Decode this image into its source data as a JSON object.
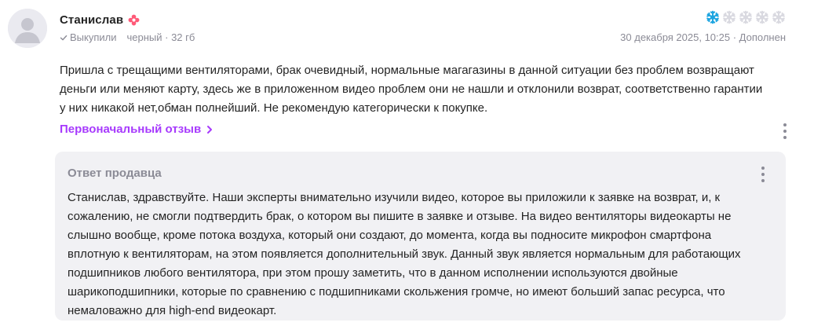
{
  "review": {
    "author": "Станислав",
    "purchased_label": "Выкупили",
    "variant": "черный · 32 гб",
    "date": "30 декабря 2025, 10:25 · Дополнен",
    "rating": 1,
    "rating_max": 5,
    "text": "Пришла с трещащими вентиляторами, брак очевидный, нормальные магагазины в данной ситуации без проблем возвращают деньги или меняют карту, здесь же в приложенном видео проблем они не нашли и отклонили возврат, соответственно гарантии у них никакой нет,обман полнейший. Не рекомендую категорически к покупке.",
    "original_link": "Первоначальный отзыв"
  },
  "seller_reply": {
    "title": "Ответ продавца",
    "text": "Станислав, здравствуйте. Наши эксперты внимательно изучили видео, которое вы приложили к заявке на возврат, и, к сожалению, не смогли подтвердить брак, о котором вы пишите в заявке и отзыве. На видео вентиляторы видеокарты не слышно вообще, кроме потока воздуха, который они создают, до момента, когда вы подносите микрофон смартфона вплотную к вентиляторам, на этом появляется дополнительный звук. Данный звук является нормальным для работающих подшипников любого вентилятора, при этом прошу заметить, что в данном исполнении используются двойные шарикоподшипники, которые по сравнению с подшипниками скольжения громче, но имеют больший запас ресурса, что немаловажно для high-end видеокарт."
  },
  "icons": {
    "avatar": "user-avatar-icon",
    "badge": "flower-badge-icon",
    "purchased": "check-icon",
    "star": "snowflake-star-icon",
    "link_arrow": "chevron-right-icon",
    "menu": "kebab-menu-icon"
  },
  "colors": {
    "accent": "#a73afd",
    "star_active": "#1ba4e0",
    "star_inactive": "#d9d9e0",
    "badge": "#ff5a78",
    "muted_text": "#8b8b96",
    "reply_background": "#f1f1f4"
  }
}
